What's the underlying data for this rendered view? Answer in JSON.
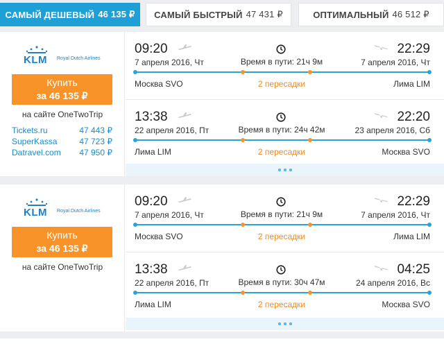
{
  "tabs": [
    {
      "label": "Самый дешевый",
      "price": "46 135 ₽",
      "active": true
    },
    {
      "label": "Самый быстрый",
      "price": "47 431 ₽",
      "active": false
    },
    {
      "label": "Оптимальный",
      "price": "46 512 ₽",
      "active": false
    }
  ],
  "colors": {
    "accent": "#1e9fd6",
    "buy": "#f79329",
    "stops": "#f08a24"
  },
  "cards": [
    {
      "airline": {
        "logo_text": "KLM",
        "subtitle": "Royal Dutch Airlines",
        "icon": "klm-crown-icon"
      },
      "buy": {
        "label": "Купить",
        "price": "за 46 135 ₽"
      },
      "site": "на сайте OneTwoTrip",
      "agents": [
        {
          "name": "Tickets.ru",
          "price": "47 443 ₽"
        },
        {
          "name": "SuperKassa",
          "price": "47 723 ₽"
        },
        {
          "name": "Datravel.com",
          "price": "47 950 ₽"
        }
      ],
      "segments": [
        {
          "dep_time": "09:20",
          "dep_date": "7 апреля 2016, Чт",
          "arr_time": "22:29",
          "arr_date": "7 апреля 2016, Чт",
          "duration": "Время в пути: 21ч 9м",
          "from": "Москва SVO",
          "to": "Лима LIM",
          "stops": "2 пересадки"
        },
        {
          "dep_time": "13:38",
          "dep_date": "22 апреля 2016, Пт",
          "arr_time": "22:20",
          "arr_date": "23 апреля 2016, Сб",
          "duration": "Время в пути: 24ч 42м",
          "from": "Лима LIM",
          "to": "Москва SVO",
          "stops": "2 пересадки"
        }
      ]
    },
    {
      "airline": {
        "logo_text": "KLM",
        "subtitle": "Royal Dutch Airlines",
        "icon": "klm-crown-icon"
      },
      "buy": {
        "label": "Купить",
        "price": "за 46 135 ₽"
      },
      "site": "на сайте OneTwoTrip",
      "segments": [
        {
          "dep_time": "09:20",
          "dep_date": "7 апреля 2016, Чт",
          "arr_time": "22:29",
          "arr_date": "7 апреля 2016, Чт",
          "duration": "Время в пути: 21ч 9м",
          "from": "Москва SVO",
          "to": "Лима LIM",
          "stops": "2 пересадки"
        },
        {
          "dep_time": "13:38",
          "dep_date": "22 апреля 2016, Пт",
          "arr_time": "04:25",
          "arr_date": "24 апреля 2016, Вс",
          "duration": "Время в пути: 30ч 47м",
          "from": "Лима LIM",
          "to": "Москва SVO",
          "stops": "2 пересадки"
        }
      ]
    }
  ]
}
